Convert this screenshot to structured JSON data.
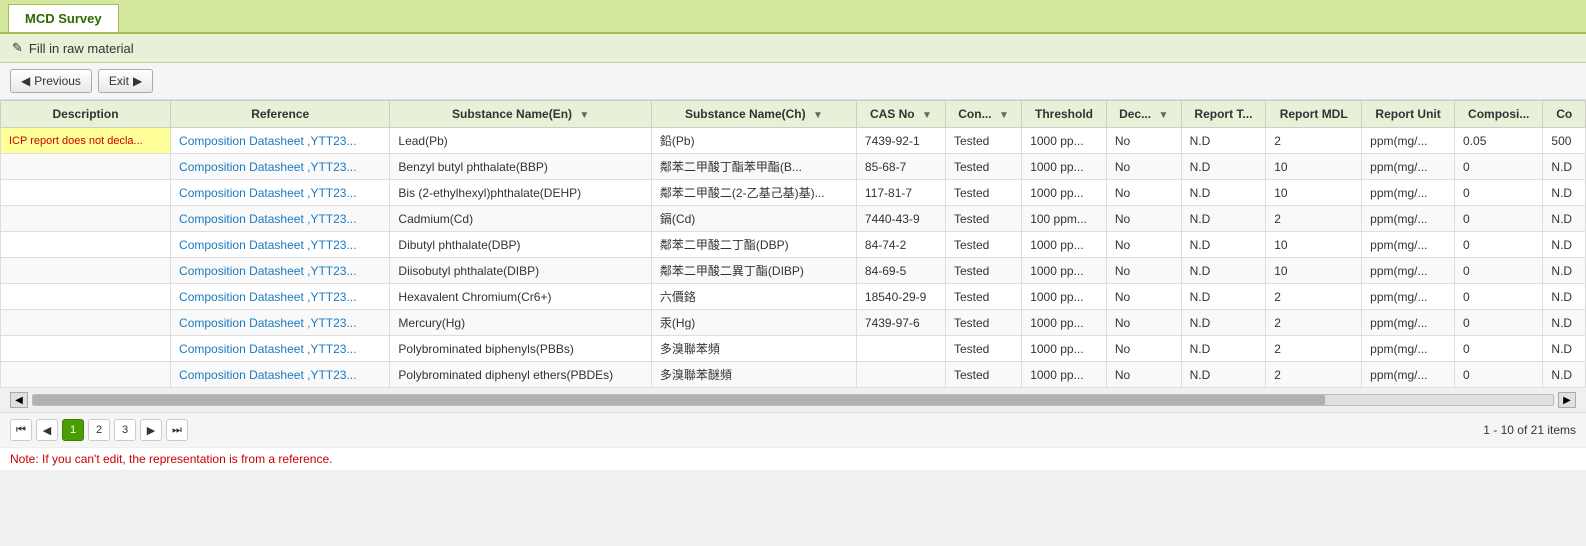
{
  "tab": {
    "label": "MCD Survey"
  },
  "header": {
    "icon": "✎",
    "title": "Fill in raw material"
  },
  "toolbar": {
    "previous_label": "Previous",
    "exit_label": "Exit"
  },
  "table": {
    "columns": [
      {
        "key": "description",
        "label": "Description",
        "filterable": false
      },
      {
        "key": "reference",
        "label": "Reference",
        "filterable": false
      },
      {
        "key": "substance_en",
        "label": "Substance Name(En)",
        "filterable": true
      },
      {
        "key": "substance_ch",
        "label": "Substance Name(Ch)",
        "filterable": true
      },
      {
        "key": "cas_no",
        "label": "CAS No",
        "filterable": true
      },
      {
        "key": "con",
        "label": "Con...",
        "filterable": true
      },
      {
        "key": "threshold",
        "label": "Threshold",
        "filterable": false
      },
      {
        "key": "dec",
        "label": "Dec...",
        "filterable": true
      },
      {
        "key": "report_t",
        "label": "Report T...",
        "filterable": false
      },
      {
        "key": "report_mdl",
        "label": "Report MDL",
        "filterable": false
      },
      {
        "key": "report_unit",
        "label": "Report Unit",
        "filterable": false
      },
      {
        "key": "composi",
        "label": "Composi...",
        "filterable": false
      },
      {
        "key": "co",
        "label": "Co",
        "filterable": false
      }
    ],
    "rows": [
      {
        "description": "ICP report does not decla...",
        "reference": "Composition Datasheet ,YTT23...",
        "substance_en": "Lead(Pb)",
        "substance_ch": "鉛(Pb)",
        "cas_no": "7439-92-1",
        "con": "Tested",
        "threshold": "1000 pp...",
        "dec": "No",
        "report_t": "N.D",
        "report_mdl": "2",
        "report_unit": "ppm(mg/...",
        "composi": "0.05",
        "co": "500"
      },
      {
        "description": "",
        "reference": "Composition Datasheet ,YTT23...",
        "substance_en": "Benzyl butyl phthalate(BBP)",
        "substance_ch": "鄰苯二甲酸丁酯苯甲酯(B...",
        "cas_no": "85-68-7",
        "con": "Tested",
        "threshold": "1000 pp...",
        "dec": "No",
        "report_t": "N.D",
        "report_mdl": "10",
        "report_unit": "ppm(mg/...",
        "composi": "0",
        "co": "N.D"
      },
      {
        "description": "",
        "reference": "Composition Datasheet ,YTT23...",
        "substance_en": "Bis (2-ethylhexyl)phthalate(DEHP)",
        "substance_ch": "鄰苯二甲酸二(2-乙基己基)基)...",
        "cas_no": "117-81-7",
        "con": "Tested",
        "threshold": "1000 pp...",
        "dec": "No",
        "report_t": "N.D",
        "report_mdl": "10",
        "report_unit": "ppm(mg/...",
        "composi": "0",
        "co": "N.D"
      },
      {
        "description": "",
        "reference": "Composition Datasheet ,YTT23...",
        "substance_en": "Cadmium(Cd)",
        "substance_ch": "鎘(Cd)",
        "cas_no": "7440-43-9",
        "con": "Tested",
        "threshold": "100 ppm...",
        "dec": "No",
        "report_t": "N.D",
        "report_mdl": "2",
        "report_unit": "ppm(mg/...",
        "composi": "0",
        "co": "N.D"
      },
      {
        "description": "",
        "reference": "Composition Datasheet ,YTT23...",
        "substance_en": "Dibutyl phthalate(DBP)",
        "substance_ch": "鄰苯二甲酸二丁酯(DBP)",
        "cas_no": "84-74-2",
        "con": "Tested",
        "threshold": "1000 pp...",
        "dec": "No",
        "report_t": "N.D",
        "report_mdl": "10",
        "report_unit": "ppm(mg/...",
        "composi": "0",
        "co": "N.D"
      },
      {
        "description": "",
        "reference": "Composition Datasheet ,YTT23...",
        "substance_en": "Diisobutyl phthalate(DIBP)",
        "substance_ch": "鄰苯二甲酸二異丁酯(DIBP)",
        "cas_no": "84-69-5",
        "con": "Tested",
        "threshold": "1000 pp...",
        "dec": "No",
        "report_t": "N.D",
        "report_mdl": "10",
        "report_unit": "ppm(mg/...",
        "composi": "0",
        "co": "N.D"
      },
      {
        "description": "",
        "reference": "Composition Datasheet ,YTT23...",
        "substance_en": "Hexavalent Chromium(Cr6+)",
        "substance_ch": "六價鉻",
        "cas_no": "18540-29-9",
        "con": "Tested",
        "threshold": "1000 pp...",
        "dec": "No",
        "report_t": "N.D",
        "report_mdl": "2",
        "report_unit": "ppm(mg/...",
        "composi": "0",
        "co": "N.D"
      },
      {
        "description": "",
        "reference": "Composition Datasheet ,YTT23...",
        "substance_en": "Mercury(Hg)",
        "substance_ch": "汞(Hg)",
        "cas_no": "7439-97-6",
        "con": "Tested",
        "threshold": "1000 pp...",
        "dec": "No",
        "report_t": "N.D",
        "report_mdl": "2",
        "report_unit": "ppm(mg/...",
        "composi": "0",
        "co": "N.D"
      },
      {
        "description": "",
        "reference": "Composition Datasheet ,YTT23...",
        "substance_en": "Polybrominated biphenyls(PBBs)",
        "substance_ch": "多溴聯苯頻",
        "cas_no": "",
        "con": "Tested",
        "threshold": "1000 pp...",
        "dec": "No",
        "report_t": "N.D",
        "report_mdl": "2",
        "report_unit": "ppm(mg/...",
        "composi": "0",
        "co": "N.D"
      },
      {
        "description": "",
        "reference": "Composition Datasheet ,YTT23...",
        "substance_en": "Polybrominated diphenyl ethers(PBDEs)",
        "substance_ch": "多溴聯苯醚頻",
        "cas_no": "",
        "con": "Tested",
        "threshold": "1000 pp...",
        "dec": "No",
        "report_t": "N.D",
        "report_mdl": "2",
        "report_unit": "ppm(mg/...",
        "composi": "0",
        "co": "N.D"
      }
    ]
  },
  "pagination": {
    "pages": [
      "1",
      "2",
      "3"
    ],
    "active_page": "1",
    "info": "1 - 10 of 21 items"
  },
  "note": {
    "text": "Note: If you can't edit, the representation is from a reference."
  }
}
